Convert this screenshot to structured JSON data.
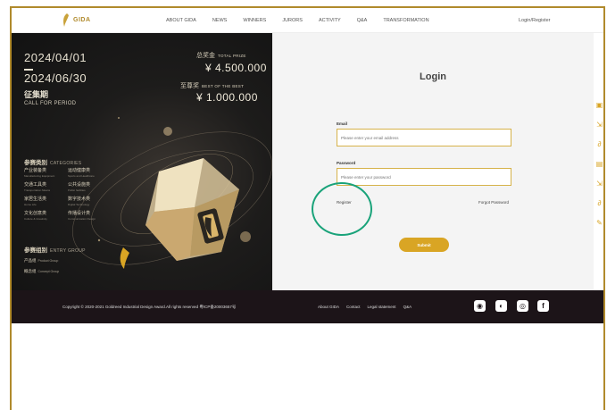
{
  "nav": {
    "logo_text": "GIDA",
    "links": [
      "ABOUT GIDA",
      "NEWS",
      "WINNERS",
      "JURORS",
      "ACTIVITY",
      "Q&A",
      "TRANSFORMATION"
    ],
    "login_register": "Login/Register"
  },
  "poster": {
    "date_start": "2024/04/01",
    "date_end": "2024/06/30",
    "period_cn": "征集期",
    "period_en": "CALL FOR PERIOD",
    "total_prize_cn": "总奖金",
    "total_prize_en": "TOTAL PRIZE",
    "total_prize_value": "¥ 4.500.000",
    "best_cn": "至尊奖",
    "best_en": "BEST OF THE BEST",
    "best_value": "¥ 1.000.000",
    "categories_cn": "参赛类别",
    "categories_en": "CATEGORIES",
    "categories": [
      {
        "cn": "产业装备类",
        "en": "Manufacturing Equipment"
      },
      {
        "cn": "运动健康类",
        "en": "Sports and Healthcare"
      },
      {
        "cn": "交通工具类",
        "en": "Transportation Means"
      },
      {
        "cn": "公共设施类",
        "en": "Public facilities"
      },
      {
        "cn": "家居生活类",
        "en": "Home Life"
      },
      {
        "cn": "数字技术类",
        "en": "Digital Technology"
      },
      {
        "cn": "文化创意类",
        "en": "Culture & Creativity"
      },
      {
        "cn": "传播设计类",
        "en": "Communication Design"
      }
    ],
    "entry_group_cn": "参赛组别",
    "entry_group_en": "ENTRY GROUP",
    "groups": [
      {
        "cn": "产品组",
        "en": "Product Group"
      },
      {
        "cn": "概念组",
        "en": "Concept Group"
      }
    ]
  },
  "login": {
    "title": "Login",
    "email_label": "Email",
    "email_placeholder": "Please enter your email address",
    "password_label": "Password",
    "password_placeholder": "Please enter your password",
    "register": "Register",
    "forgot": "Forgot Password",
    "submit": "Submit"
  },
  "footer": {
    "copyright": "Copyright © 2020-2021 Goldreed Industrial Design Award.All rights reserved  粤ICP备20003657号",
    "links": [
      "About GIDA",
      "Contact",
      "Legal statement",
      "Q&A"
    ]
  },
  "colors": {
    "accent": "#d9a524",
    "footer_bg": "#1c1418",
    "annotation": "#1aa37a"
  }
}
